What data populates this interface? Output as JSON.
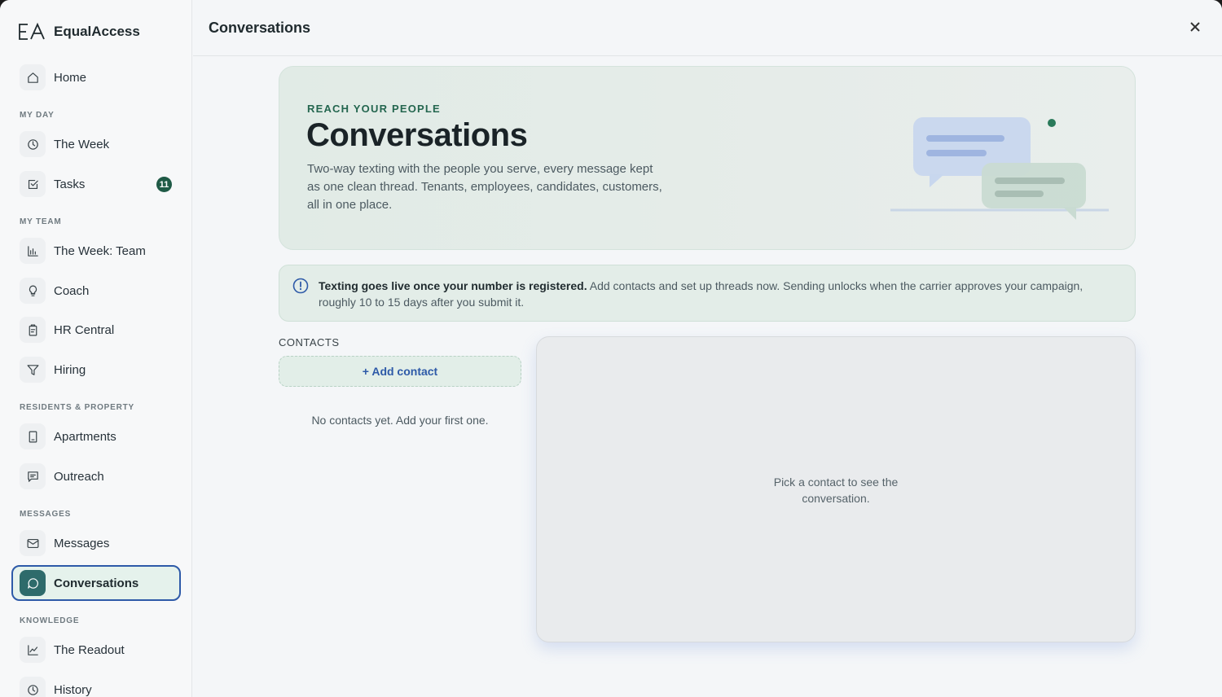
{
  "brand": {
    "logo_text": "EA",
    "name": "EqualAccess"
  },
  "sidebar": {
    "home": {
      "label": "Home",
      "icon": "home-icon"
    },
    "sections": {
      "my_day": "MY DAY",
      "my_team": "MY TEAM",
      "residents": "RESIDENTS & PROPERTY",
      "messages": "MESSAGES",
      "knowledge": "KNOWLEDGE"
    },
    "items": {
      "the_week": {
        "label": "The Week",
        "icon": "clock-icon"
      },
      "tasks": {
        "label": "Tasks",
        "icon": "checkbox-icon",
        "badge": "11"
      },
      "the_week_team": {
        "label": "The Week: Team",
        "icon": "bar-chart-icon"
      },
      "coach": {
        "label": "Coach",
        "icon": "lightbulb-icon"
      },
      "hr_central": {
        "label": "HR Central",
        "icon": "clipboard-icon"
      },
      "hiring": {
        "label": "Hiring",
        "icon": "funnel-icon"
      },
      "apartments": {
        "label": "Apartments",
        "icon": "building-icon"
      },
      "outreach": {
        "label": "Outreach",
        "icon": "comment-box-icon"
      },
      "messages": {
        "label": "Messages",
        "icon": "mail-icon"
      },
      "conversations": {
        "label": "Conversations",
        "icon": "chat-bubble-icon",
        "active": true
      },
      "the_readout": {
        "label": "The Readout",
        "icon": "line-chart-icon"
      },
      "history": {
        "label": "History",
        "icon": "clock-icon"
      }
    }
  },
  "topbar": {
    "title": "Conversations"
  },
  "hero": {
    "eyebrow": "REACH YOUR PEOPLE",
    "title": "Conversations",
    "description": "Two-way texting with the people you serve, every message kept as one clean thread. Tenants, employees, candidates, customers, all in one place."
  },
  "notice": {
    "bold": "Texting goes live once your number is registered.",
    "text": " Add contacts and set up threads now. Sending unlocks when the carrier approves your campaign, roughly 10 to 15 days after you submit it."
  },
  "contacts": {
    "label": "CONTACTS",
    "add_button": "+ Add contact",
    "empty": "No contacts yet. Add your first one."
  },
  "thread": {
    "empty": "Pick a contact to see the conversation."
  },
  "colors": {
    "accent_green": "#1f5a46",
    "active_border": "#2e5aa8",
    "link_blue": "#2e5aa8"
  }
}
